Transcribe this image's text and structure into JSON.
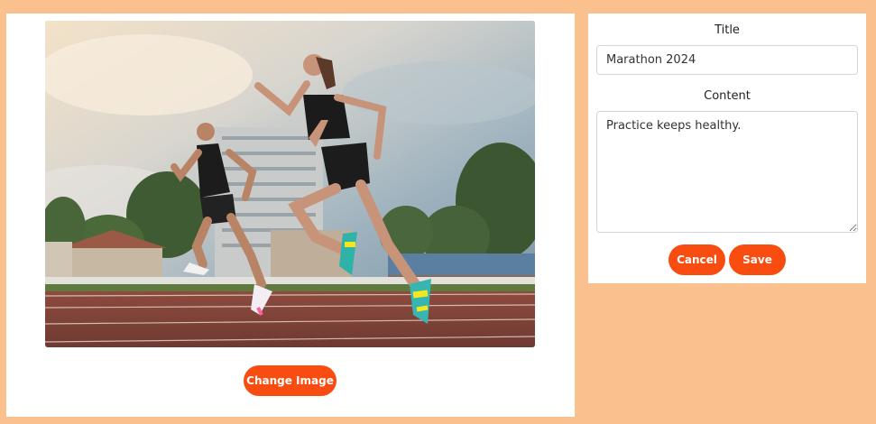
{
  "image_panel": {
    "photo_alt": "Two runners sprinting on a running track",
    "change_image_label": "Change Image"
  },
  "form": {
    "title_label": "Title",
    "title_value": "Marathon 2024",
    "content_label": "Content",
    "content_value": "Practice keeps healthy.",
    "cancel_label": "Cancel",
    "save_label": "Save"
  },
  "colors": {
    "page_background": "#fac08e",
    "accent": "#f94c10"
  }
}
